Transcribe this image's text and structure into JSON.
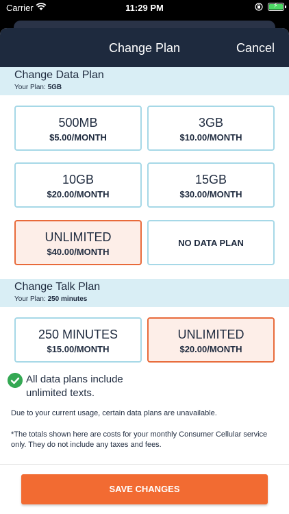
{
  "status_bar": {
    "carrier": "Carrier",
    "time": "11:29 PM",
    "battery_icon": "battery-charging-icon"
  },
  "nav": {
    "title": "Change Plan",
    "cancel_label": "Cancel"
  },
  "data_section": {
    "heading": "Change Data Plan",
    "your_plan_label": "Your Plan:",
    "your_plan_value": "5GB",
    "plans": [
      {
        "name": "500MB",
        "price": "$5.00/MONTH",
        "selected": false
      },
      {
        "name": "3GB",
        "price": "$10.00/MONTH",
        "selected": false
      },
      {
        "name": "10GB",
        "price": "$20.00/MONTH",
        "selected": false
      },
      {
        "name": "15GB",
        "price": "$30.00/MONTH",
        "selected": false
      },
      {
        "name": "UNLIMITED",
        "price": "$40.00/MONTH",
        "selected": true
      },
      {
        "name": "NO DATA PLAN",
        "price": "",
        "selected": false
      }
    ]
  },
  "talk_section": {
    "heading": "Change Talk Plan",
    "your_plan_label": "Your Plan:",
    "your_plan_value": "250 minutes",
    "plans": [
      {
        "name": "250 MINUTES",
        "price": "$15.00/MONTH",
        "selected": false
      },
      {
        "name": "UNLIMITED",
        "price": "$20.00/MONTH",
        "selected": true
      }
    ]
  },
  "notes": {
    "texts_included": "All data plans include unlimited texts.",
    "usage_notice": "Due to your current usage, certain data plans are unavailable.",
    "disclaimer": "*The totals shown here are costs for your monthly Consumer Cellular service only. They do not include any taxes and fees."
  },
  "footer": {
    "save_label": "SAVE CHANGES"
  },
  "colors": {
    "nav_bg": "#1e2a3e",
    "section_bg": "#d9eef5",
    "accent": "#f26b32",
    "selected_border": "#e86a3a",
    "tile_border": "#a6d8e7",
    "check_green": "#34a853"
  }
}
